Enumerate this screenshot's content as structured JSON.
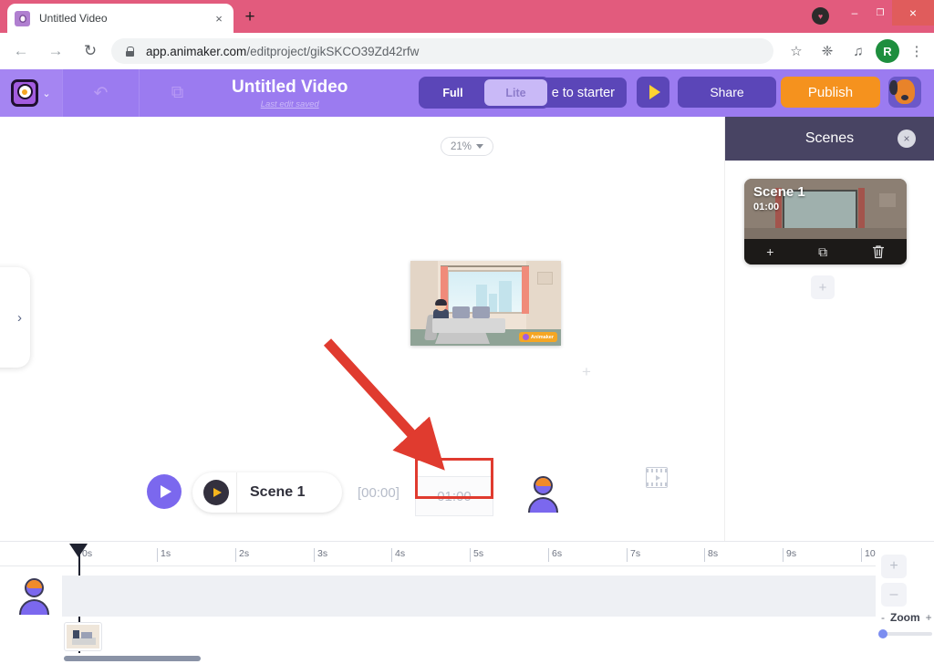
{
  "browser": {
    "tab": {
      "title": "Untitled Video",
      "favicon": "animaker-favicon",
      "close": "×"
    },
    "new_tab": "+",
    "window_controls": {
      "minimize": "–",
      "maximize": "❐",
      "close": "×",
      "heart_dot": "♥"
    },
    "nav": {
      "back": "←",
      "forward": "→",
      "reload": "↻"
    },
    "omnibox": {
      "lock": "lock-icon",
      "domain": "app.animaker.com",
      "path": "/editproject/gikSKCO39Zd42rfw"
    },
    "toolbar_icons": {
      "bookmark": "☆",
      "extensions": "❈",
      "media": "♫",
      "profile_initial": "R",
      "menu": "⋮"
    }
  },
  "app_toolbar": {
    "logo": "animaker-logo",
    "logo_caret": "⌄",
    "undo_icon": "↶",
    "duplicate_icon": "⧉",
    "project_title": "Untitled Video",
    "project_subtitle": "Last edit saved",
    "upgrade_label": "e to starter",
    "mode_full": "Full",
    "mode_lite": "Lite",
    "play_label": "play-icon",
    "share_label": "Share",
    "publish_label": "Publish",
    "avatar": "dog-avatar"
  },
  "stage": {
    "zoom_level": "21%",
    "zoom_caret": "▾",
    "side_tab_chevron": "›",
    "plus_marker": "+",
    "watermark": "Animaker"
  },
  "scene_bar": {
    "play": "play-icon",
    "pill_play": "play-icon",
    "scene_label": "Scene 1",
    "time_start": "[00:00]",
    "time_duration": "01:00",
    "character_icon": "character-icon",
    "video_icon": "film-icon"
  },
  "annotations": {
    "arrow_color": "#e03b2f",
    "box_color": "#e03b2f",
    "target": "01:00"
  },
  "scenes_panel": {
    "title": "Scenes",
    "close": "×",
    "scene": {
      "label": "Scene 1",
      "duration": "01:00",
      "actions": {
        "add": "+",
        "duplicate": "⧉",
        "delete": "Ὕ1"
      }
    },
    "add_scene": "+"
  },
  "timeline": {
    "ticks": [
      "0s",
      "1s",
      "2s",
      "3s",
      "4s",
      "5s",
      "6s",
      "7s",
      "8s",
      "9s",
      "10"
    ],
    "track_avatar": "character-icon",
    "clip": "scene-1-clip",
    "zoom_in": "+",
    "zoom_out": "–",
    "zoom_minus": "-",
    "zoom_label": "Zoom",
    "zoom_plus": "+"
  },
  "colors": {
    "brand_purple": "#9b7bf0",
    "toolbar_dark": "#5b46b8",
    "publish_orange": "#f5921e",
    "panel_header": "#484463",
    "annotation_red": "#e03b2f",
    "tabstrip_pink": "#e25b7d"
  }
}
